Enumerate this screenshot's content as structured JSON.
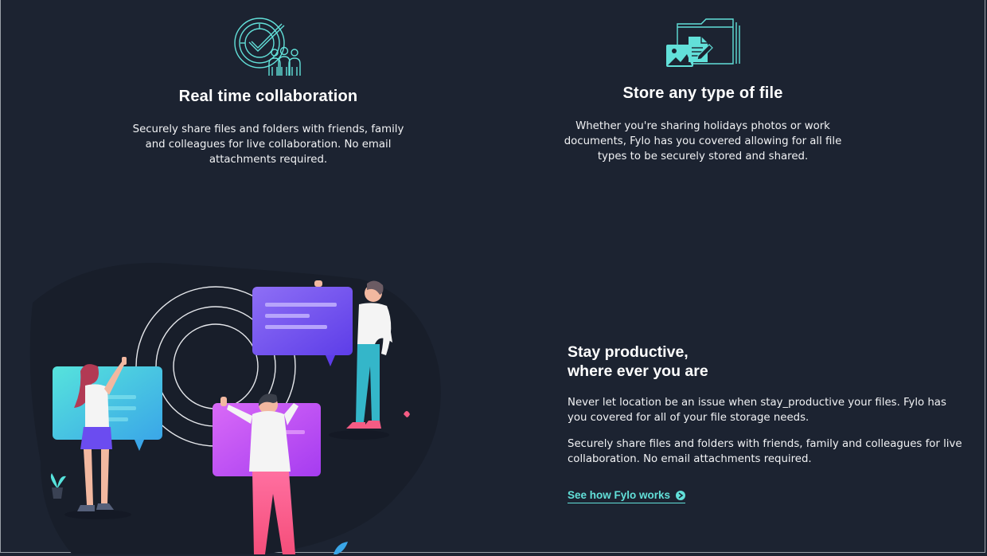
{
  "features": [
    {
      "icon": "collaboration-icon",
      "title": "Real time collaboration",
      "description": "Securely share files and folders with friends, family and colleagues for live collaboration. No email attachments required."
    },
    {
      "icon": "any-file-icon",
      "title": "Store any type of file",
      "description": "Whether you're sharing holidays photos or work documents, Fylo has you covered allowing for all file types to be securely stored and shared."
    }
  ],
  "productive": {
    "heading_line1": "Stay productive,",
    "heading_line2": "where ever you are",
    "paragraph1": "Never let location be an issue when stay_productive your files. Fylo has you covered for all of your file storage needs.",
    "paragraph2": "Securely share files and folders with friends, family and colleagues for live collaboration. No email attachments required.",
    "cta_label": "See how Fylo works",
    "cta_icon": "arrow-circle-right-icon",
    "illustration": "stay-productive-illustration"
  },
  "colors": {
    "background": "#1c2331",
    "blob": "#181e2a",
    "accent_cyan": "#62e0d9",
    "text": "#ffffff"
  }
}
